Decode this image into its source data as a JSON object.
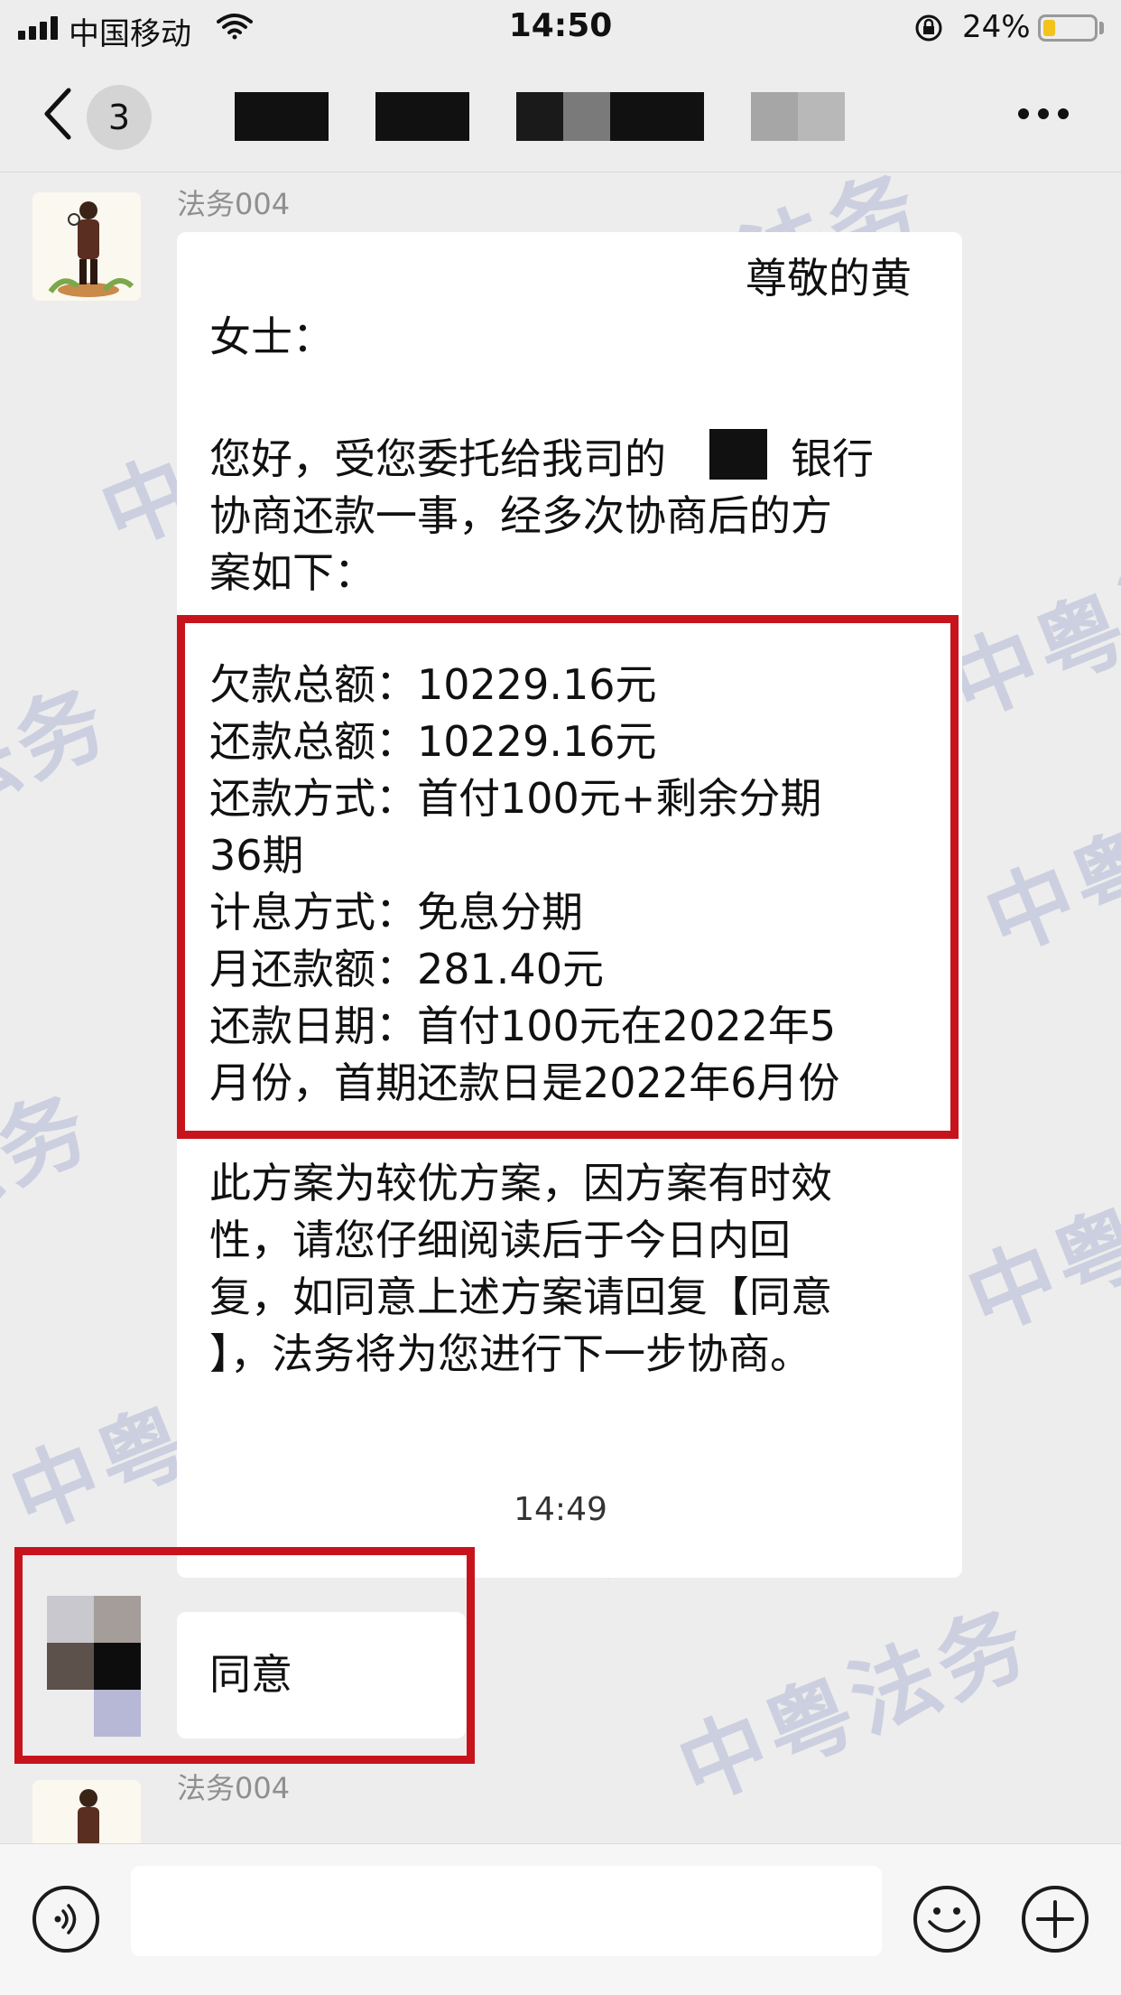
{
  "status_bar": {
    "carrier": "中国移动",
    "time": "14:50",
    "battery_percent": "24%",
    "battery_level": 0.24,
    "battery_color": "#f2c31a"
  },
  "nav": {
    "unread_count": "3",
    "back_icon": "chevron-left-icon",
    "more_icon": "more-horizontal-icon"
  },
  "chat": {
    "watermark": [
      "中粤法务",
      "中粤法务",
      "中粤法务",
      "中粤法务",
      "中粤法务",
      "中粤法务",
      "中粤法务",
      "中粤法务",
      "中粤法务",
      "中粤法务"
    ],
    "messages": [
      {
        "sender": "法务004",
        "greeting_line1": "尊敬的黄",
        "greeting_line2": "女士：",
        "intro": "您好，受您委托给我司的　　　银行\n协商还款一事，经多次协商后的方\n案如下：",
        "plan": "欠款总额：10229.16元\n还款总额：10229.16元\n还款方式：首付100元+剩余分期\n36期\n计息方式：免息分期\n月还款额：281.40元\n还款日期：首付100元在2022年5\n月份，首期还款日是2022年6月份",
        "closing": "此方案为较优方案，因方案有时效\n性，请您仔细阅读后于今日内回\n复，如同意上述方案请回复【同意\n】，法务将为您进行下一步协商。"
      }
    ],
    "time_separator": "14:49",
    "reply_text": "同意",
    "next_sender": "法务004",
    "highlight_color": "#c7141c"
  },
  "input_bar": {
    "voice_icon": "voice-icon",
    "emoji_icon": "emoji-icon",
    "plus_icon": "plus-icon",
    "input_value": ""
  }
}
